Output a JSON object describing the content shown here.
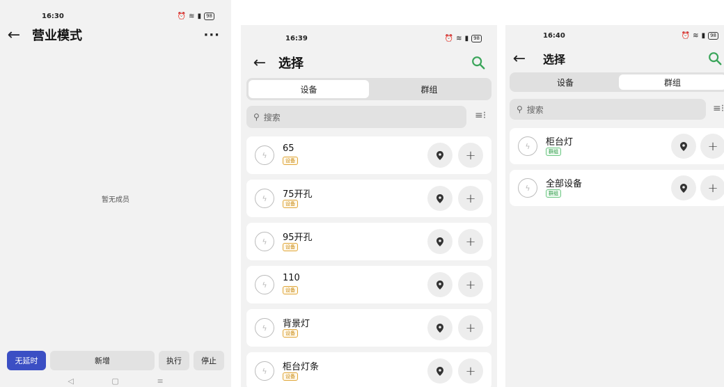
{
  "screen1": {
    "time": "16:30",
    "battery": "98",
    "title": "营业模式",
    "more": "···",
    "empty_text": "暂无成员",
    "buttons": {
      "delay": "无延时",
      "add": "新增",
      "execute": "执行",
      "stop": "停止"
    },
    "nav": {
      "back": "◁",
      "home": "▢",
      "menu": "≡"
    }
  },
  "screen2": {
    "time": "16:39",
    "battery": "98",
    "title": "选择",
    "tabs": [
      "设备",
      "群组"
    ],
    "active_tab": 0,
    "search_placeholder": "搜索",
    "items": [
      {
        "name": "65",
        "tag": "设备"
      },
      {
        "name": "75开孔",
        "tag": "设备"
      },
      {
        "name": "95开孔",
        "tag": "设备"
      },
      {
        "name": "110",
        "tag": "设备"
      },
      {
        "name": "背景灯",
        "tag": "设备"
      },
      {
        "name": "柜台灯条",
        "tag": "设备"
      }
    ]
  },
  "screen3": {
    "time": "16:40",
    "battery": "98",
    "title": "选择",
    "tabs": [
      "设备",
      "群组"
    ],
    "active_tab": 1,
    "search_placeholder": "搜索",
    "items": [
      {
        "name": "柜台灯",
        "tag": "群组"
      },
      {
        "name": "全部设备",
        "tag": "群组"
      }
    ]
  },
  "colors": {
    "accent_green": "#3aa55a",
    "primary_blue": "#3b4fc4",
    "device_tag": "#c98a12",
    "group_tag": "#2e9a47"
  },
  "icons": [
    "back-arrow-icon",
    "more-icon",
    "search-icon",
    "filter-list-icon",
    "bulb-icon",
    "location-pin-icon",
    "plus-icon"
  ]
}
